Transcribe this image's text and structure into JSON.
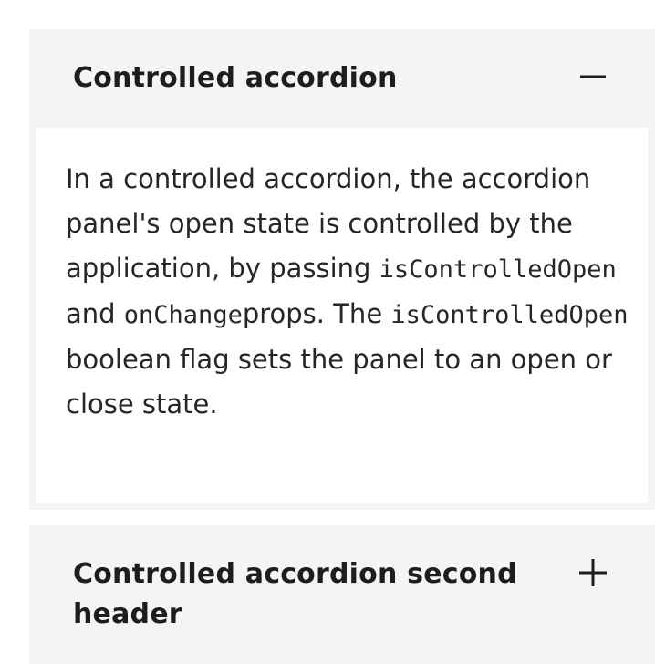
{
  "accordion": {
    "items": [
      {
        "title": "Controlled accordion",
        "expanded": true,
        "toggle_icon": "minus-icon",
        "panel": {
          "text_1": "In a controlled accordion, the accordion panel's open state is controlled by the application, by passing ",
          "code_1": "isControlledOpen",
          "text_2": " and ",
          "code_2": "onChange",
          "text_3": "props. The ",
          "code_3": "isControlledOpen",
          "text_4": " boolean flag sets the panel to an open or close state."
        }
      },
      {
        "title": "Controlled accordion second header",
        "expanded": false,
        "toggle_icon": "plus-icon"
      }
    ]
  },
  "colors": {
    "item_background": "#f4f4f4",
    "panel_background": "#ffffff",
    "text": "#161616"
  }
}
